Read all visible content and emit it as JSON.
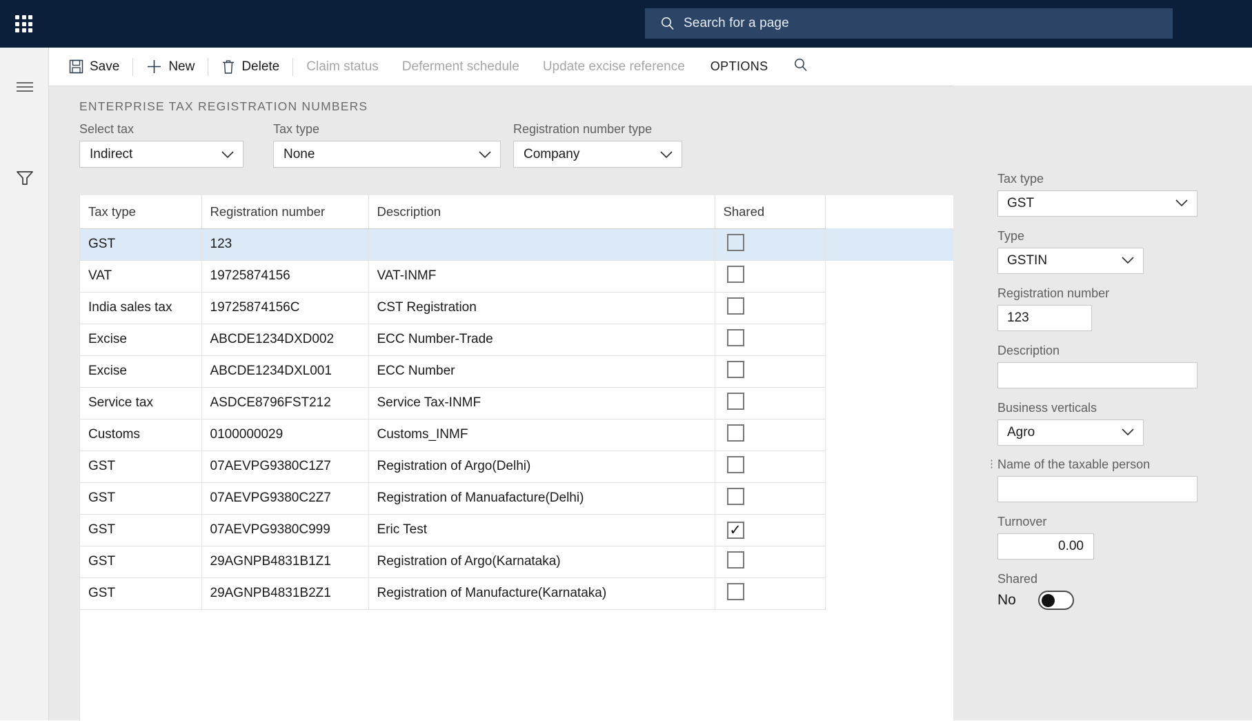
{
  "topbar": {
    "waffle_icon": "app-launcher-icon",
    "search": {
      "icon": "search-icon",
      "placeholder": "Search for a page",
      "value": ""
    }
  },
  "leftrail": {
    "hamburger_icon": "hamburger-menu-icon",
    "filter_icon": "filter-funnel-icon"
  },
  "toolbar": {
    "save_label": "Save",
    "save_icon": "save-disk-icon",
    "new_label": "New",
    "new_icon": "plus-icon",
    "delete_label": "Delete",
    "delete_icon": "trash-icon",
    "claim_status_label": "Claim status",
    "deferment_schedule_label": "Deferment schedule",
    "update_excise_label": "Update excise reference",
    "options_label": "OPTIONS",
    "search_icon": "search-icon"
  },
  "main": {
    "section_title": "ENTERPRISE TAX REGISTRATION NUMBERS",
    "filters": [
      {
        "label": "Select tax",
        "value": "Indirect"
      },
      {
        "label": "Tax type",
        "value": "None"
      },
      {
        "label": "Registration number type",
        "value": "Company"
      }
    ],
    "grid": {
      "columns": [
        "Tax type",
        "Registration number",
        "Description",
        "Shared"
      ],
      "rows": [
        {
          "tax_type": "GST",
          "registration_number": "123",
          "description": "",
          "shared": false,
          "selected": true
        },
        {
          "tax_type": "VAT",
          "registration_number": "19725874156",
          "description": "VAT-INMF",
          "shared": false,
          "selected": false
        },
        {
          "tax_type": "India sales tax",
          "registration_number": "19725874156C",
          "description": "CST Registration",
          "shared": false,
          "selected": false
        },
        {
          "tax_type": "Excise",
          "registration_number": "ABCDE1234DXD002",
          "description": "ECC Number-Trade",
          "shared": false,
          "selected": false
        },
        {
          "tax_type": "Excise",
          "registration_number": "ABCDE1234DXL001",
          "description": "ECC Number",
          "shared": false,
          "selected": false
        },
        {
          "tax_type": "Service tax",
          "registration_number": "ASDCE8796FST212",
          "description": "Service Tax-INMF",
          "shared": false,
          "selected": false
        },
        {
          "tax_type": "Customs",
          "registration_number": "0100000029",
          "description": "Customs_INMF",
          "shared": false,
          "selected": false
        },
        {
          "tax_type": "GST",
          "registration_number": "07AEVPG9380C1Z7",
          "description": "Registration of Argo(Delhi)",
          "shared": false,
          "selected": false
        },
        {
          "tax_type": "GST",
          "registration_number": "07AEVPG9380C2Z7",
          "description": "Registration of Manuafacture(Delhi)",
          "shared": false,
          "selected": false
        },
        {
          "tax_type": "GST",
          "registration_number": "07AEVPG9380C999",
          "description": "Eric Test",
          "shared": true,
          "selected": false
        },
        {
          "tax_type": "GST",
          "registration_number": "29AGNPB4831B1Z1",
          "description": "Registration of Argo(Karnataka)",
          "shared": false,
          "selected": false
        },
        {
          "tax_type": "GST",
          "registration_number": "29AGNPB4831B2Z1",
          "description": "Registration of Manufacture(Karnataka)",
          "shared": false,
          "selected": false
        }
      ]
    }
  },
  "details": {
    "tax_type": {
      "label": "Tax type",
      "value": "GST"
    },
    "type": {
      "label": "Type",
      "value": "GSTIN"
    },
    "registration_number": {
      "label": "Registration number",
      "value": "123"
    },
    "description": {
      "label": "Description",
      "value": ""
    },
    "business_verticals": {
      "label": "Business verticals",
      "value": "Agro"
    },
    "taxable_person": {
      "label": "Name of the taxable person",
      "value": ""
    },
    "turnover": {
      "label": "Turnover",
      "value": "0.00"
    },
    "shared": {
      "label": "Shared",
      "value": "No",
      "on": false
    }
  },
  "colors": {
    "topbar": "#0b1f3a",
    "search_field": "#2c4466",
    "page_background": "#e9e9e9",
    "grid_background": "#ffffff",
    "selected_row": "#dce9f7",
    "link": "#1567b5",
    "disabled_text": "#a6a6a6"
  }
}
